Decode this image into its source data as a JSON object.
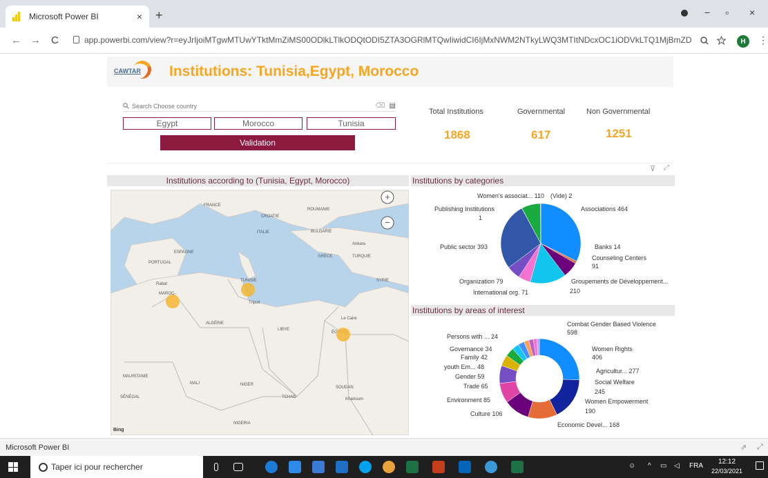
{
  "browser": {
    "tab_title": "Microsoft Power BI",
    "tab_close": "×",
    "new_tab": "+",
    "url": "app.powerbi.com/view?r=eyJrIjoiMTgwMTUwYTktMmZiMS00ODlkLTlkODQtODI5ZTA3OGRlMTQwIiwidCI6IjMxNWM2NTkyLWQ3MTItNDcxOC1iODVkLTQ1MjBmZDNiZmYy...",
    "back": "←",
    "forward": "→",
    "reload": "C",
    "minimize": "−",
    "restore": "▫",
    "close": "×",
    "profile_initial": "H"
  },
  "report": {
    "logo_text": "CAWTAR",
    "title": "Institutions: Tunisia,Egypt, Morocco",
    "search_placeholder": "Search Choose country",
    "countries": [
      "Egypt",
      "Morocco",
      "Tunisia"
    ],
    "validation_label": "Validation",
    "kpis": [
      {
        "label": "Total Institutions",
        "value": "1868"
      },
      {
        "label": "Governmental",
        "value": "617"
      },
      {
        "label": "Non Governmental",
        "value": "1251"
      }
    ],
    "map_title": "Institutions according to (Tunisia, Egypt, Morocco)",
    "map_labels": [
      "FRANCE",
      "ESPAGNE",
      "PORTUGAL",
      "ITALIE",
      "ROUMANIE",
      "CROATIE",
      "BULGARIE",
      "TURQUIE",
      "GRÈCE",
      "SYRIE",
      "Rabat",
      "MAROC",
      "TUNISIE",
      "ALGÉRIE",
      "LIBYE",
      "ÉGYPTE",
      "MAURITANIE",
      "MALI",
      "NIGER",
      "TCHAD",
      "SOUDAN",
      "NIGERIA",
      "SÉNÉGAL",
      "Tripoli",
      "Le Caire",
      "Ankara",
      "Khartoum"
    ],
    "map_attribution": "Bing",
    "zoom_in": "+",
    "zoom_out": "−"
  },
  "chart_data": [
    {
      "type": "pie",
      "title": "Institutions by categories",
      "slices": [
        {
          "label": "Associations",
          "value": 464,
          "color": "#118dff"
        },
        {
          "label": "Banks",
          "value": 14,
          "color": "#e66c37"
        },
        {
          "label": "Counseling Centers",
          "value": 91,
          "color": "#6b007b"
        },
        {
          "label": "Groupements de Développement...",
          "value": 210,
          "color": "#12c5ed"
        },
        {
          "label": "International org.",
          "value": 71,
          "color": "#f472d0"
        },
        {
          "label": "Organization",
          "value": 79,
          "color": "#744ec2"
        },
        {
          "label": "Public sector",
          "value": 393,
          "color": "#3257a8"
        },
        {
          "label": "Publishing Institutions",
          "value": 1,
          "color": "#d9b300"
        },
        {
          "label": "Women's associat...",
          "value": 110,
          "color": "#1aab40"
        },
        {
          "label": "(Vide)",
          "value": 2,
          "color": "#e044a7"
        }
      ],
      "label_texts": {
        "associations": "Associations 464",
        "banks": "Banks 14",
        "counseling": "Counseling Centers",
        "counseling_val": "91",
        "groupements": "Groupements de Développement...",
        "groupements_val": "210",
        "intl": "International org. 71",
        "org": "Organization 79",
        "public": "Public sector 393",
        "publishing": "Publishing Institutions",
        "publishing_val": "1",
        "womens": "Women's associat... 110",
        "vide": "(Vide) 2"
      }
    },
    {
      "type": "pie",
      "title": "Institutions by areas of interest",
      "slices": [
        {
          "label": "Combat Gender Based Violence",
          "value": 598,
          "color": "#118dff"
        },
        {
          "label": "Women Rights",
          "value": 406,
          "color": "#12239e"
        },
        {
          "label": "Agricultur...",
          "value": 277,
          "color": "#e66c37"
        },
        {
          "label": "Social Welfare",
          "value": 245,
          "color": "#6b007b"
        },
        {
          "label": "Women Empowerment",
          "value": 190,
          "color": "#e044a7"
        },
        {
          "label": "Economic Devel...",
          "value": 168,
          "color": "#744ec2"
        },
        {
          "label": "Culture",
          "value": 106,
          "color": "#d9b300"
        },
        {
          "label": "Environment",
          "value": 85,
          "color": "#1aab40"
        },
        {
          "label": "Trade",
          "value": 65,
          "color": "#15c6f4"
        },
        {
          "label": "Gender",
          "value": 59,
          "color": "#4092ff"
        },
        {
          "label": "youth Em...",
          "value": 48,
          "color": "#ffa058"
        },
        {
          "label": "Family",
          "value": 42,
          "color": "#be5dc9"
        },
        {
          "label": "Governance",
          "value": 34,
          "color": "#f472d0"
        },
        {
          "label": "Persons with ...",
          "value": 24,
          "color": "#b5a1ff"
        }
      ],
      "label_texts": {
        "combat": "Combat Gender Based Violence",
        "combat_val": "598",
        "rights": "Women Rights",
        "rights_val": "406",
        "agri": "Agricultur... 277",
        "social": "Social Welfare",
        "social_val": "245",
        "empower": "Women Empowerment",
        "empower_val": "190",
        "econ": "Economic Devel... 168",
        "culture": "Culture 106",
        "env": "Environment 85",
        "trade": "Trade 65",
        "gender": "Gender 59",
        "youth": "youth Em... 48",
        "family": "Family 42",
        "gov": "Governance 34",
        "persons": "Persons with ... 24"
      }
    }
  ],
  "footer": {
    "app_name": "Microsoft Power BI"
  },
  "taskbar": {
    "search_placeholder": "Taper ici pour rechercher",
    "lang": "FRA",
    "time": "12:12",
    "date": "22/03/2021"
  }
}
